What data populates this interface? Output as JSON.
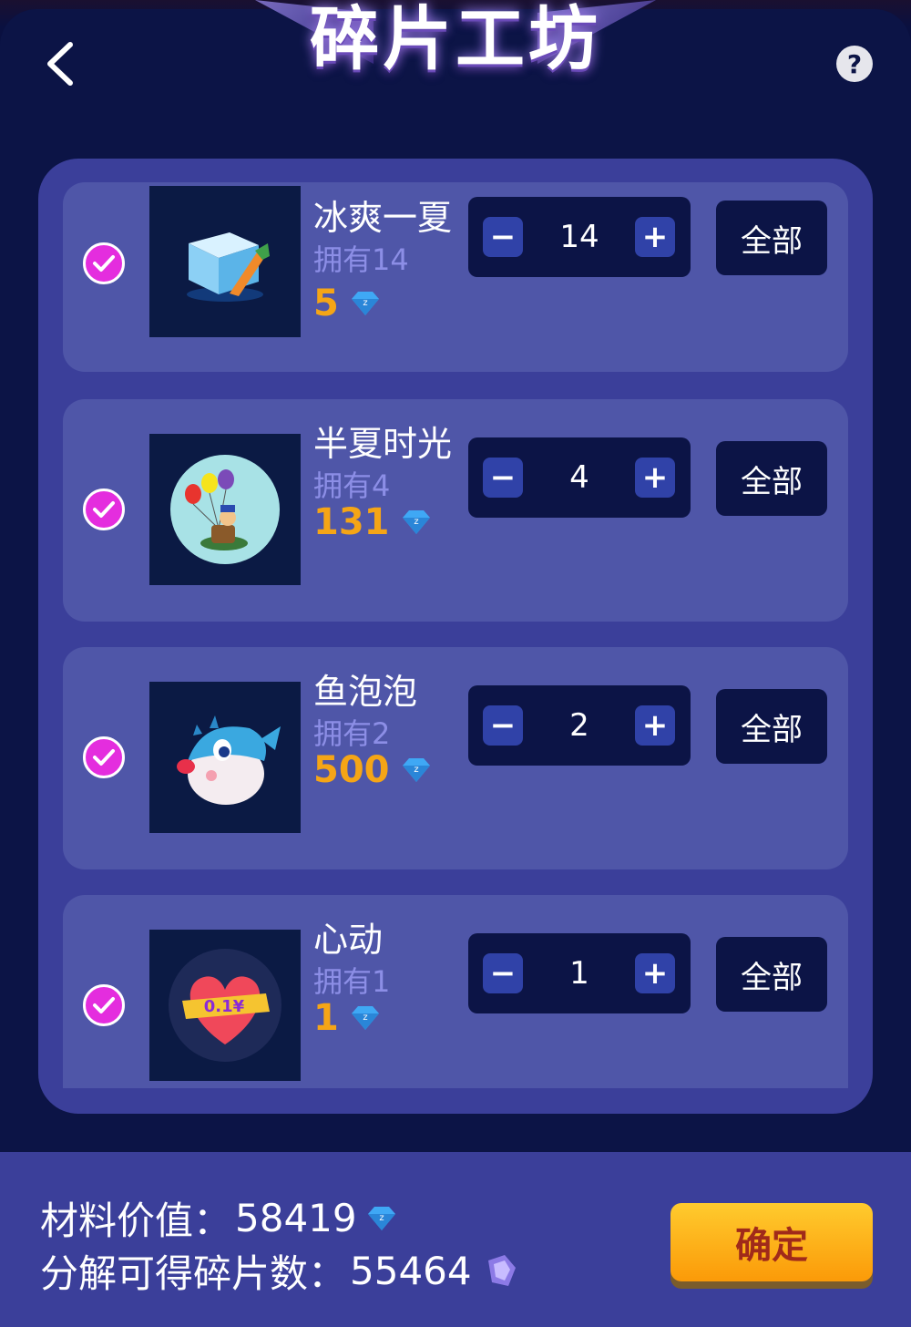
{
  "header": {
    "title": "碎片工坊",
    "back_icon": "chevron-left-icon",
    "help_label": "?"
  },
  "items": [
    {
      "name": "冰爽一夏",
      "owned": "拥有14",
      "price": "5",
      "quantity": "14",
      "all_label": "全部",
      "checked": true,
      "thumb_icon": "ice-box-icon"
    },
    {
      "name": "半夏时光",
      "owned": "拥有4",
      "price": "131",
      "quantity": "4",
      "all_label": "全部",
      "checked": true,
      "thumb_icon": "balloon-scene-icon"
    },
    {
      "name": "鱼泡泡",
      "owned": "拥有2",
      "price": "500",
      "quantity": "2",
      "all_label": "全部",
      "checked": true,
      "thumb_icon": "pufferfish-icon"
    },
    {
      "name": "心动",
      "owned": "拥有1",
      "price": "1",
      "quantity": "1",
      "all_label": "全部",
      "checked": true,
      "thumb_icon": "heart-icon",
      "thumb_text": "0.1¥"
    }
  ],
  "stepper": {
    "minus": "−",
    "plus": "+"
  },
  "footer": {
    "material_label": "材料价值：",
    "material_value": "58419",
    "shards_label": "分解可得碎片数：",
    "shards_value": "55464",
    "confirm_label": "确定"
  },
  "colors": {
    "background": "#0c1446",
    "panel": "#3b3f9a",
    "card": "#4f56a8",
    "check": "#e42dde",
    "price": "#f5a516",
    "gem": "#3fa8f5",
    "confirm": "#fbb01a"
  }
}
